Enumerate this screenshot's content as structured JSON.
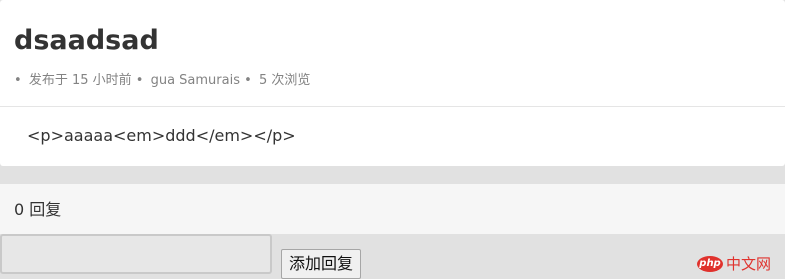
{
  "topic": {
    "title": "dsaadsad",
    "meta": {
      "posted": "发布于 15 小时前",
      "author": "gua Samurais",
      "views": "5 次浏览",
      "separator": "•"
    },
    "body": "<p>aaaaa<em>ddd</em></p>"
  },
  "replies": {
    "count_label": "0 回复",
    "textarea_value": "",
    "submit_label": "添加回复"
  },
  "watermark": {
    "logo_text": "php",
    "site_name": "中文网"
  },
  "colors": {
    "page_background": "#e1e1e1",
    "card_background": "#ffffff",
    "reply_header_background": "#f6f6f6",
    "meta_text": "#838383",
    "primary_text": "#333333",
    "watermark_red": "#e0322d"
  }
}
